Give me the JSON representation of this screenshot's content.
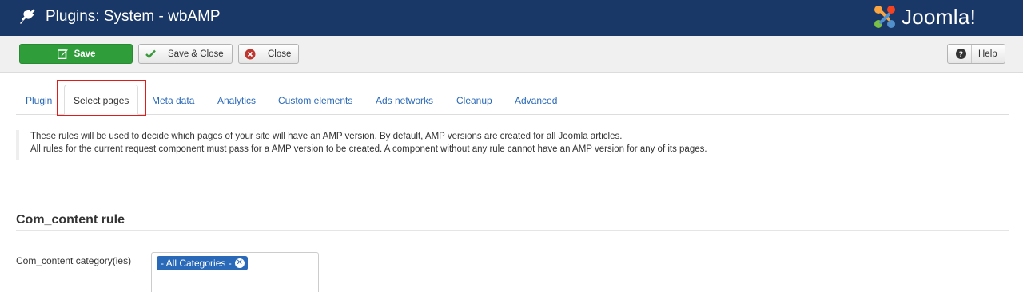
{
  "header": {
    "title": "Plugins: System - wbAMP",
    "title_icon": "plug-icon",
    "brand": "Joomla!"
  },
  "toolbar": {
    "save_label": "Save",
    "save_close_label": "Save & Close",
    "close_label": "Close",
    "help_label": "Help"
  },
  "tabs": [
    {
      "label": "Plugin"
    },
    {
      "label": "Select pages",
      "active": true
    },
    {
      "label": "Meta data"
    },
    {
      "label": "Analytics"
    },
    {
      "label": "Custom elements"
    },
    {
      "label": "Ads networks"
    },
    {
      "label": "Cleanup"
    },
    {
      "label": "Advanced"
    }
  ],
  "note": {
    "line1": "These rules will be used to decide which pages of your site will have an AMP version. By default, AMP versions are created for all Joomla articles.",
    "line2": "All rules for the current request component must pass for a AMP version to be created. A component without any rule cannot have an AMP version for any of its pages."
  },
  "section": {
    "title": "Com_content rule",
    "field_label": "Com_content category(ies)",
    "selected": [
      "- All Categories -"
    ]
  },
  "colors": {
    "header_bg": "#1a3867",
    "save_green": "#2f9e3a",
    "link_blue": "#2a69b8",
    "highlight_red": "#e01b1b"
  }
}
